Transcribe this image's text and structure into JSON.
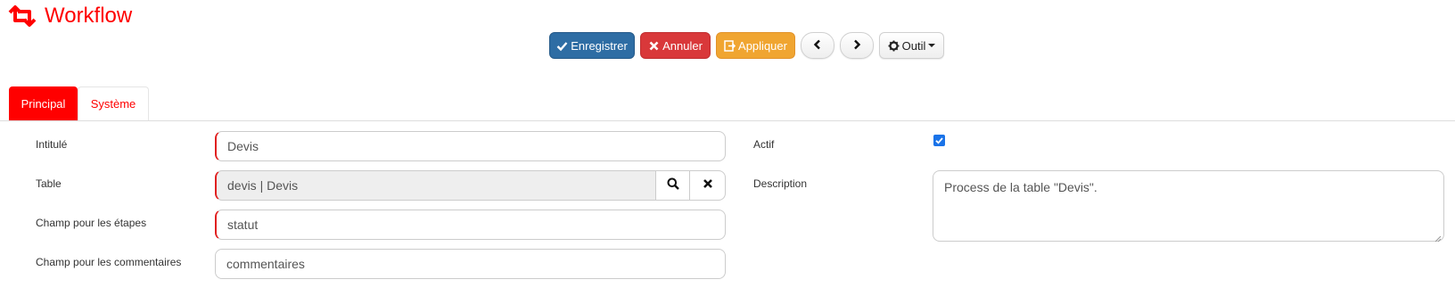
{
  "header": {
    "title": "Workflow",
    "icon": "retweet-icon"
  },
  "toolbar": {
    "save_label": "Enregistrer",
    "cancel_label": "Annuler",
    "apply_label": "Appliquer",
    "tool_label": "Outil"
  },
  "tabs": [
    {
      "label": "Principal",
      "active": true
    },
    {
      "label": "Système",
      "active": false
    }
  ],
  "form": {
    "intitule": {
      "label": "Intitulé",
      "value": "Devis"
    },
    "table": {
      "label": "Table",
      "value": "devis | Devis"
    },
    "champ_etapes": {
      "label": "Champ pour les étapes",
      "value": "statut"
    },
    "champ_commentaires": {
      "label": "Champ pour les commentaires",
      "value": "commentaires"
    },
    "actif": {
      "label": "Actif",
      "checked": true
    },
    "description": {
      "label": "Description",
      "value": "Process de la table \"Devis\"."
    }
  },
  "colors": {
    "accent": "#ff0000",
    "primary": "#2e6da4",
    "danger": "#d9383a",
    "warning": "#f0a531",
    "checkbox": "#1a73e8"
  }
}
